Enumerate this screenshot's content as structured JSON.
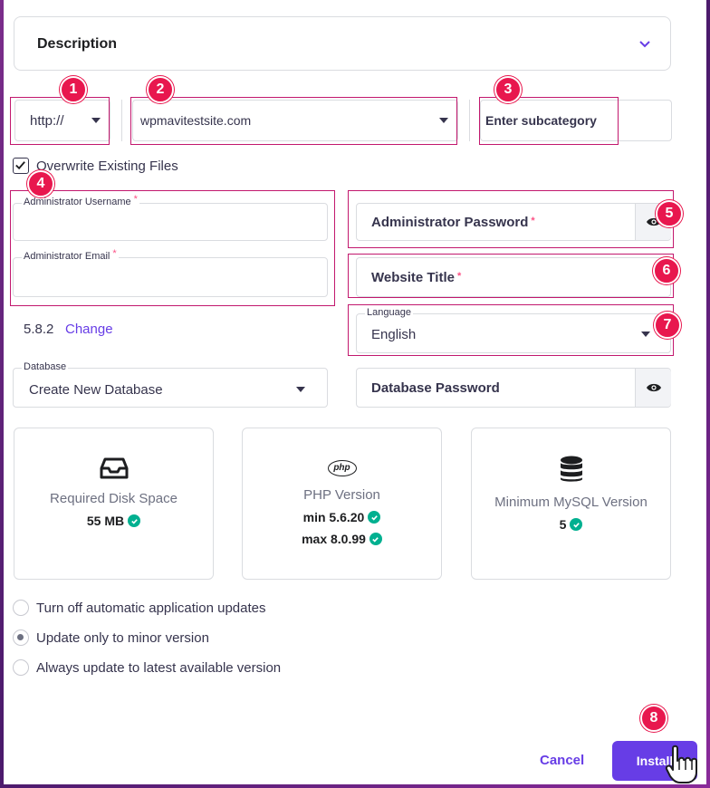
{
  "description": {
    "title": "Description"
  },
  "protocol": {
    "value": "http://"
  },
  "domain": {
    "value": "wpmavitestsite.com"
  },
  "subcategory": {
    "placeholder": "Enter subcategory"
  },
  "overwrite": {
    "label": "Overwrite Existing Files",
    "checked": true
  },
  "admin_username": {
    "label": "Administrator Username",
    "required": "*"
  },
  "admin_email": {
    "label": "Administrator Email",
    "required": "*"
  },
  "admin_password": {
    "placeholder": "Administrator Password",
    "required": "*"
  },
  "website_title": {
    "placeholder": "Website Title",
    "required": "*"
  },
  "language": {
    "label": "Language",
    "value": "English"
  },
  "version": {
    "value": "5.8.2",
    "change_label": "Change"
  },
  "database": {
    "label": "Database",
    "value": "Create New Database"
  },
  "database_password": {
    "placeholder": "Database Password"
  },
  "cards": {
    "disk": {
      "title": "Required Disk Space",
      "value": "55 MB"
    },
    "php": {
      "icon_label": "php",
      "title": "PHP Version",
      "min": "min 5.6.20",
      "max": "max 8.0.99"
    },
    "mysql": {
      "title": "Minimum MySQL Version",
      "value": "5"
    }
  },
  "updates": {
    "options": [
      {
        "label": "Turn off automatic application updates"
      },
      {
        "label": "Update only to minor version"
      },
      {
        "label": "Always update to latest available version"
      }
    ],
    "selected": 1
  },
  "actions": {
    "cancel": "Cancel",
    "install": "Install"
  },
  "badges": [
    "1",
    "2",
    "3",
    "4",
    "5",
    "6",
    "7",
    "8"
  ],
  "colors": {
    "accent": "#673de6",
    "success": "#00b090",
    "highlight": "#c2186e",
    "badge": "#e8174e"
  }
}
